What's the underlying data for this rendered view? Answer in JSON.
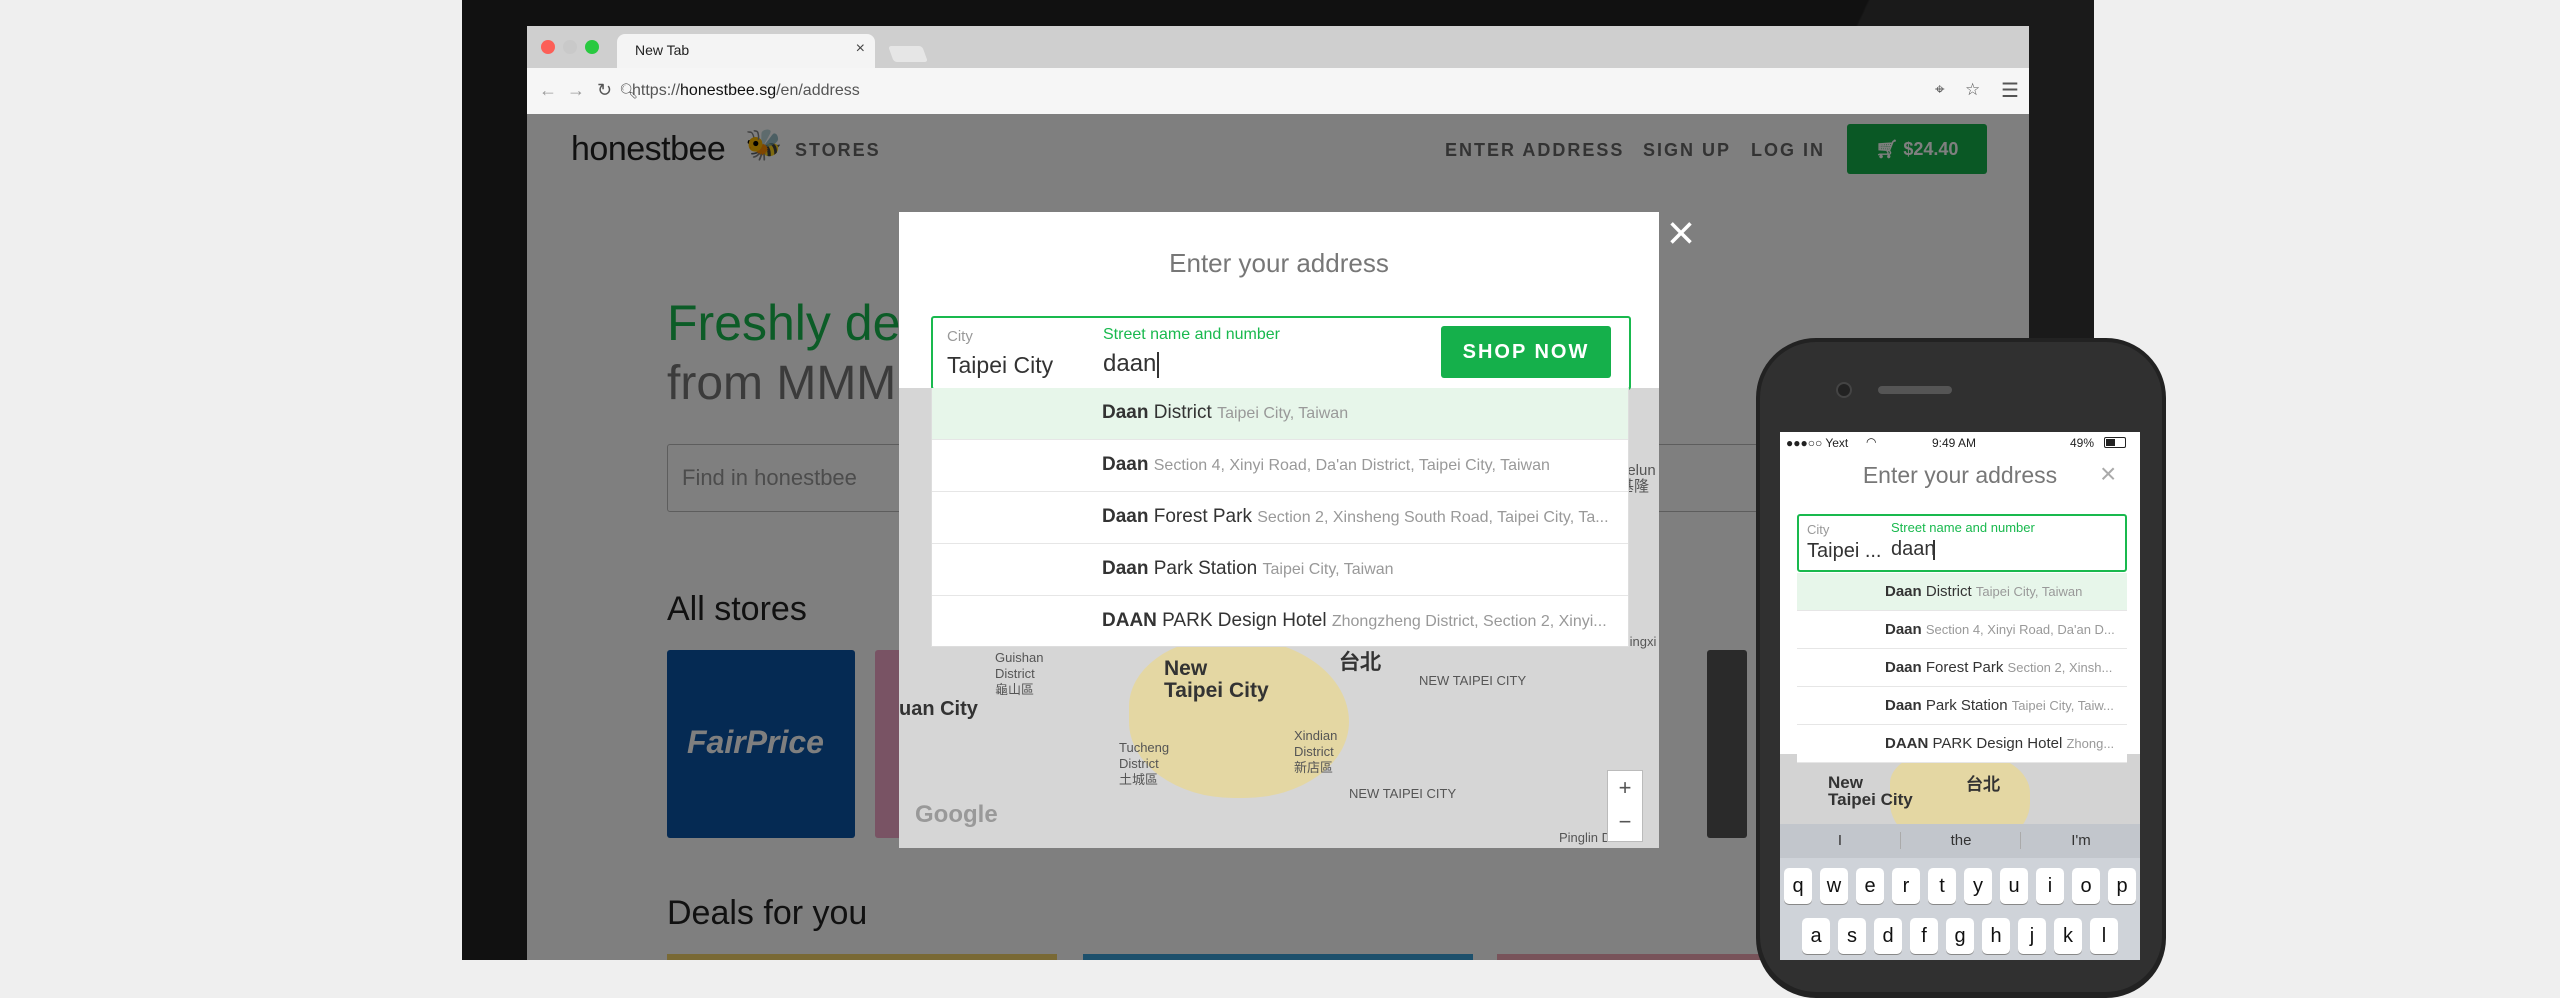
{
  "browser": {
    "tab_title": "New Tab",
    "tab_close": "×",
    "url_prefix": "https://",
    "url_host": "honestbee.sg",
    "url_path": "/en/address"
  },
  "site": {
    "logo": "honestbee",
    "stores_link": "STORES",
    "enter_address": "ENTER ADDRESS",
    "sign_up": "SIGN UP",
    "log_in": "LOG IN",
    "cart_total": "$24.40",
    "hero_line1": "Freshly de",
    "hero_line2": "from MMM",
    "find_placeholder": "Find in honestbee",
    "all_stores": "All stores",
    "fairprice": "FairPrice",
    "deals": "Deals for you"
  },
  "modal": {
    "title": "Enter your address",
    "close": "×",
    "city_label": "City",
    "city_value": "Taipei City",
    "street_label": "Street name and number",
    "street_value": "daan",
    "shop_now": "SHOP NOW",
    "suggestions": [
      {
        "bold": "Daan",
        "main": " District",
        "sub": "Taipei City, Taiwan"
      },
      {
        "bold": "Daan",
        "main": "",
        "sub": "Section 4, Xinyi Road, Da'an District, Taipei City, Taiwan"
      },
      {
        "bold": "Daan",
        "main": " Forest Park",
        "sub": "Section 2, Xinsheng South Road, Taipei City, Ta..."
      },
      {
        "bold": "Daan",
        "main": " Park Station",
        "sub": "Taipei City, Taiwan"
      },
      {
        "bold": "DAAN",
        "main": " PARK Design Hotel",
        "sub": "Zhongzheng District, Section 2, Xinyi..."
      }
    ],
    "map": {
      "new_taipei": "New\nTaipei City",
      "taipei": "台北",
      "guishan": "Guishan\nDistrict\n龜山區",
      "tucheng": "Tucheng\nDistrict\n土城區",
      "xindian": "Xindian\nDistrict\n新店區",
      "new_taipei_small": "NEW TAIPEI CITY",
      "new_taipei_small2": "NEW TAIPEI CITY",
      "pinglin": "Pinglin District",
      "uan_city": "uan City",
      "keelung": "eelun\n基隆",
      "pingxi": "Pingxi",
      "zoom_in": "+",
      "zoom_out": "−",
      "google": "Google"
    }
  },
  "phone": {
    "carrier": "●●●○○ Yext",
    "time": "9:49 AM",
    "battery": "49%",
    "title": "Enter your address",
    "close": "×",
    "city_label": "City",
    "city_value": "Taipei ...",
    "street_label": "Street name and number",
    "street_value": "daan",
    "suggestions": [
      {
        "bold": "Daan",
        "main": " District",
        "sub": "Taipei City, Taiwan"
      },
      {
        "bold": "Daan",
        "main": "",
        "sub": "Section 4, Xinyi Road, Da'an D..."
      },
      {
        "bold": "Daan",
        "main": " Forest Park",
        "sub": "Section 2, Xinsh..."
      },
      {
        "bold": "Daan",
        "main": " Park Station",
        "sub": "Taipei City, Taiw..."
      },
      {
        "bold": "DAAN",
        "main": " PARK Design Hotel",
        "sub": "Zhong..."
      }
    ],
    "map_new": "New\nTaipei City",
    "map_taipei": "台北",
    "predictions": [
      "I",
      "the",
      "I'm"
    ],
    "row1": [
      "q",
      "w",
      "e",
      "r",
      "t",
      "y",
      "u",
      "i",
      "o",
      "p"
    ],
    "row2": [
      "a",
      "s",
      "d",
      "f",
      "g",
      "h",
      "j",
      "k",
      "l"
    ]
  }
}
